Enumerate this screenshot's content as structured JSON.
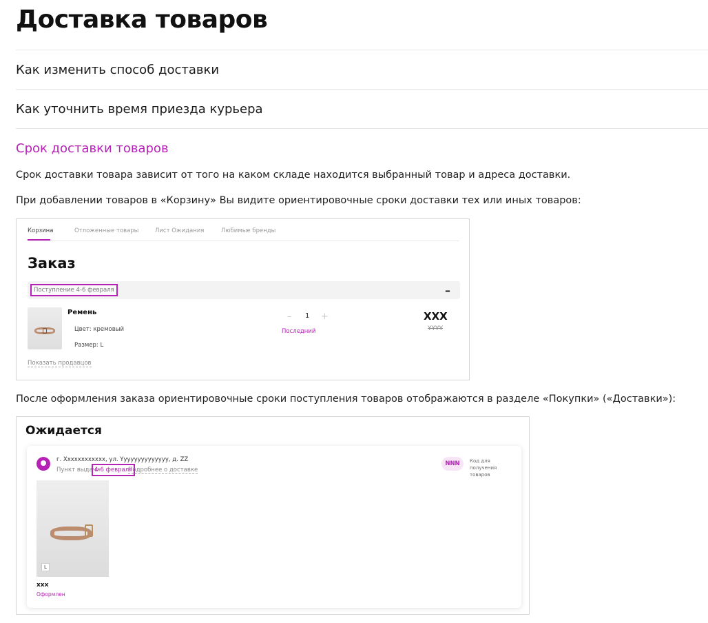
{
  "page": {
    "title": "Доставка товаров",
    "faq": [
      "Как изменить способ доставки",
      "Как уточнить время приезда курьера",
      "Срок доставки товаров"
    ],
    "paragraphs": [
      "Срок доставки товара зависит от того на каком складе находится выбранный товар и адреса доставки.",
      "При добавлении товаров в «Корзину» Вы видите ориентировочные сроки доставки тех или иных товаров:",
      "После оформления заказа ориентировочные сроки поступления товаров отображаются в разделе «Покупки» («Доставки»):"
    ],
    "accent_color": "#b621b6"
  },
  "cart": {
    "tabs": [
      "Корзина",
      "Отложенные товары",
      "Лист Ожидания",
      "Любимые бренды"
    ],
    "order_title": "Заказ",
    "delivery_date": "Поступление 4-6 февраля",
    "collapse": "–",
    "product": {
      "name": "Ремень",
      "color": "Цвет: кремовый",
      "size": "Размер: L",
      "qty_minus": "–",
      "qty": "1",
      "qty_plus": "+",
      "last_label": "Последний",
      "price": "XXX",
      "old_price": "YYYY"
    },
    "show_sellers": "Показать продавцов"
  },
  "expected": {
    "title": "Ожидается",
    "address": "г. Xxxxxxxxxxxx, ул. Yyyyyyyyyyyyyy, д. ZZ",
    "pickup_label": "Пункт выдачи",
    "pickup_date": "4-6 февраля",
    "details_link": "Подробнее о доставке",
    "code": "NNN",
    "code_label": "Код для получения товаров",
    "item_size": "L",
    "item_price": "xxx",
    "item_status": "Оформлен"
  }
}
